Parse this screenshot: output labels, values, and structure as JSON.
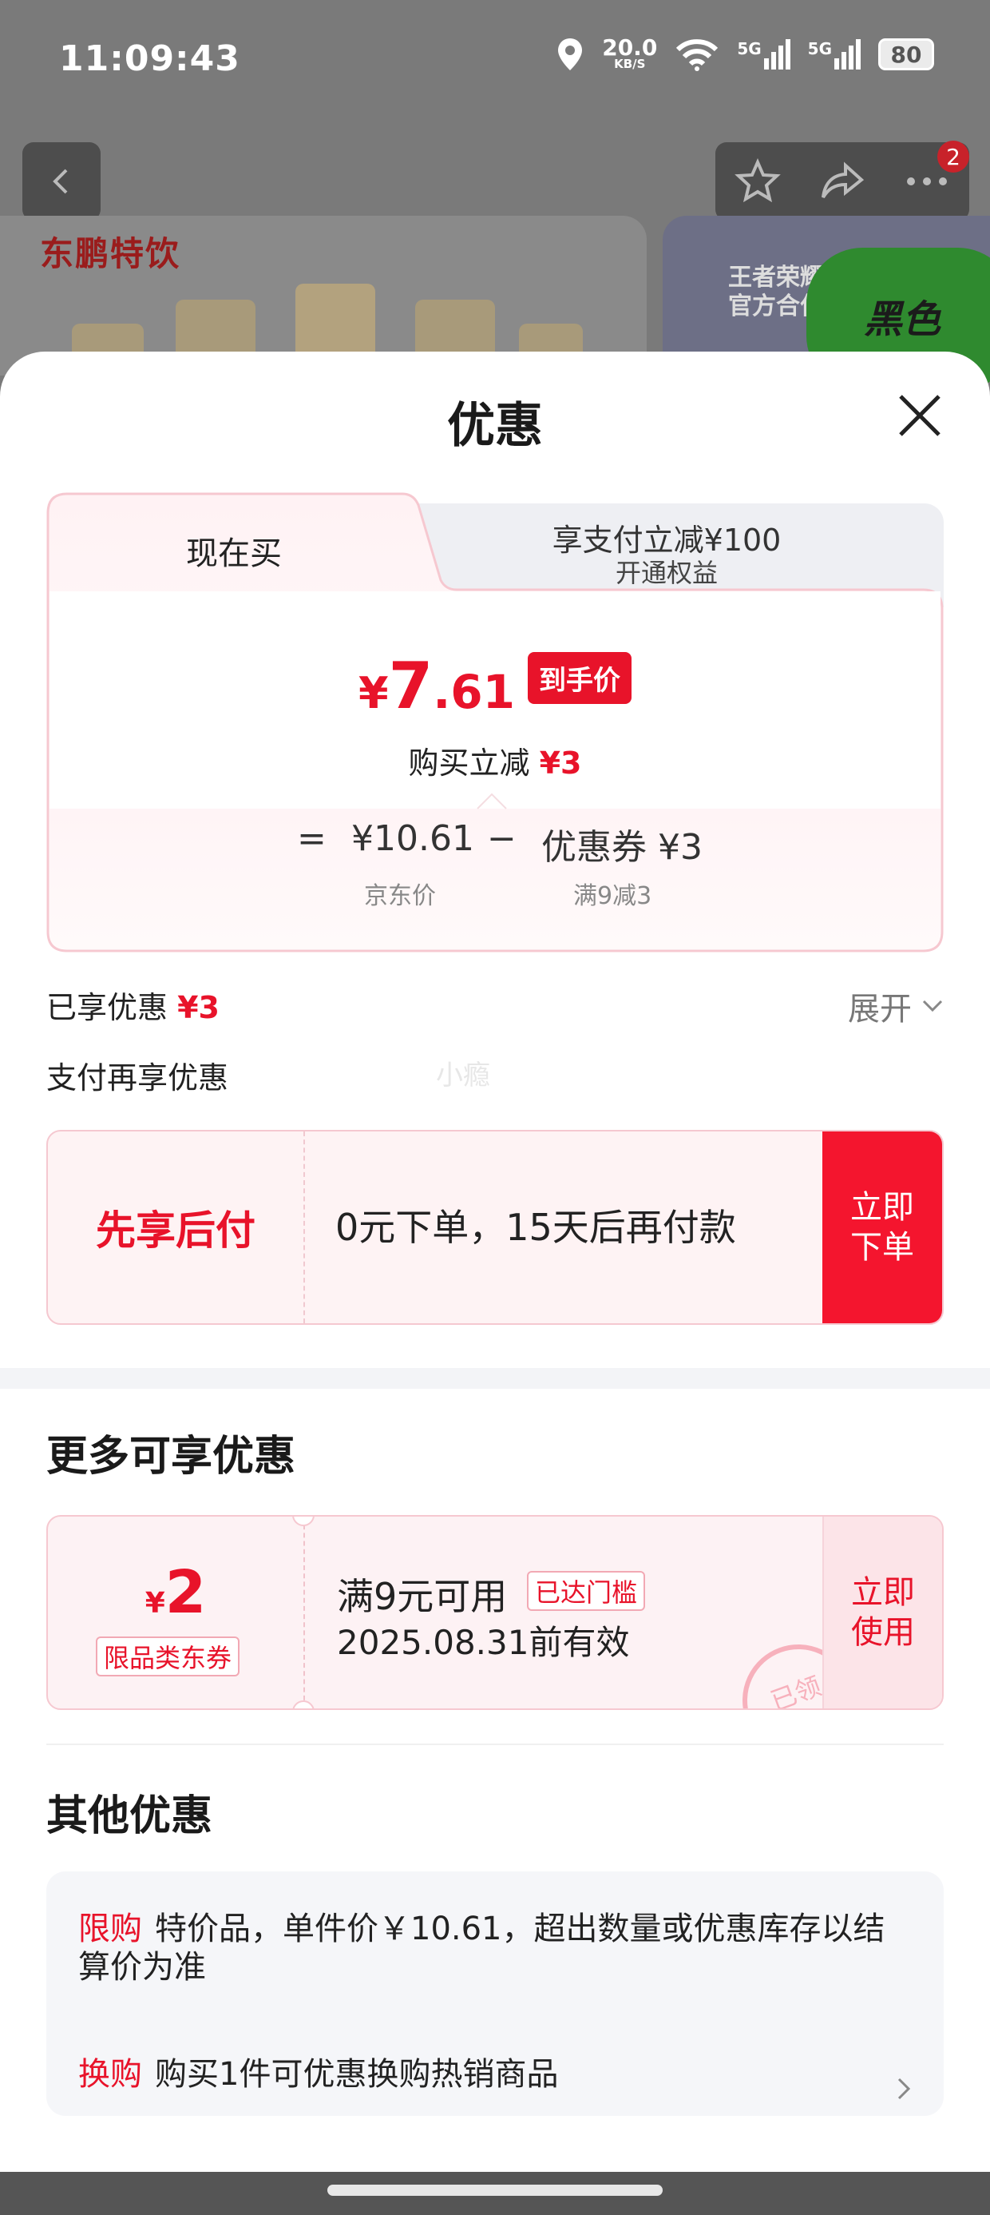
{
  "status_bar": {
    "time": "11:09:43",
    "net_speed": "20.0",
    "net_unit": "KB/S",
    "signal1": "5G",
    "signal2": "5G",
    "battery": "80"
  },
  "background": {
    "brand": "东鹏特饮",
    "banner_text": "王者荣耀\n官方合作",
    "banner_badge": "黑色",
    "cart_count": "2"
  },
  "sheet": {
    "title": "优惠",
    "tabs": {
      "now": "现在买",
      "alt_main": "享支付立减¥100",
      "alt_sub": "开通权益"
    },
    "final": {
      "currency": "¥",
      "integer": "7",
      "decimal": ".61",
      "tag": "到手价"
    },
    "reduce_label": "购买立减",
    "reduce_value": "¥3",
    "formula": {
      "equals": "=",
      "price": "¥10.61",
      "minus": "−",
      "coupon_label": "优惠券",
      "coupon_value": "¥3",
      "price_sub": "京东价",
      "coupon_sub": "满9减3"
    },
    "enjoyed_label": "已享优惠",
    "enjoyed_value": "¥3",
    "expand_label": "展开",
    "pay_more_label": "支付再享优惠",
    "watermark": "小瘾",
    "pay_later": {
      "title": "先享后付",
      "desc": "0元下单，15天后再付款",
      "button": "立即\n下单"
    },
    "more_title": "更多可享优惠",
    "coupon": {
      "currency": "¥",
      "value": "2",
      "type": "限品类东券",
      "condition": "满9元可用",
      "threshold_tag": "已达门槛",
      "expire": "2025.08.31前有效",
      "stamp": "已领",
      "button": "立即\n使用"
    },
    "other_title": "其他优惠",
    "other": [
      {
        "tag": "限购",
        "text": "特价品，单件价￥10.61，超出数量或优惠库存以结算价为准"
      },
      {
        "tag": "换购",
        "text": "购买1件可优惠换购热销商品"
      }
    ]
  },
  "colors": {
    "accent": "#e8132a",
    "panel_border": "#f6c8d0"
  }
}
